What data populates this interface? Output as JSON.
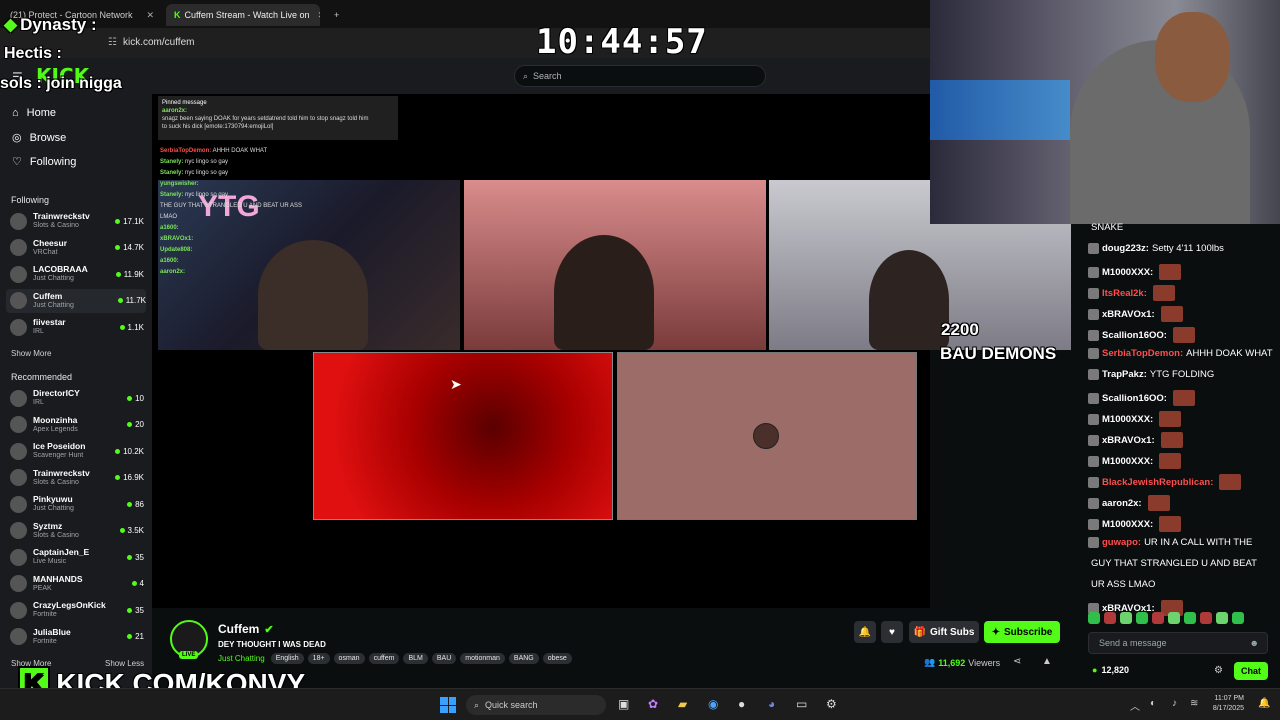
{
  "browser": {
    "tabs": [
      {
        "label": "(21) Protect - Cartoon Network",
        "active": false
      },
      {
        "label": "Cuffem Stream - Watch Live on",
        "active": true
      }
    ],
    "url": "kick.com/cuffem"
  },
  "overlay": {
    "clock": "10:44:57",
    "team": "Dynasty :",
    "user1": "Hectis :",
    "user2_text": "sols : join nigga",
    "brand": "KICK.COM/KONVY",
    "cam_label_line1": "2200",
    "cam_label_line2": "BAU DEMONS"
  },
  "search": {
    "placeholder": "Search"
  },
  "nav": {
    "home": "Home",
    "browse": "Browse",
    "following": "Following"
  },
  "following_title": "Following",
  "following": [
    {
      "name": "Trainwreckstv",
      "cat": "Slots & Casino",
      "viewers": "17.1K"
    },
    {
      "name": "Cheesur",
      "cat": "VRChat",
      "viewers": "14.7K"
    },
    {
      "name": "LACOBRAAA",
      "cat": "Just Chatting",
      "viewers": "11.9K"
    },
    {
      "name": "Cuffem",
      "cat": "Just Chatting",
      "viewers": "11.7K"
    },
    {
      "name": "fiivestar",
      "cat": "IRL",
      "viewers": "1.1K"
    }
  ],
  "show_more": "Show More",
  "recommended_title": "Recommended",
  "recommended": [
    {
      "name": "DirectorICY",
      "cat": "IRL",
      "viewers": "10"
    },
    {
      "name": "Moonzinha",
      "cat": "Apex Legends",
      "viewers": "20"
    },
    {
      "name": "Ice Poseidon",
      "cat": "Scavenger Hunt",
      "viewers": "10.2K"
    },
    {
      "name": "Trainwreckstv",
      "cat": "Slots & Casino",
      "viewers": "16.9K"
    },
    {
      "name": "Pinkyuwu",
      "cat": "Just Chatting",
      "viewers": "86"
    },
    {
      "name": "Syztmz",
      "cat": "Slots & Casino",
      "viewers": "3.5K"
    },
    {
      "name": "CaptainJen_E",
      "cat": "Live Music",
      "viewers": "35"
    },
    {
      "name": "MANHANDS",
      "cat": "PEAK",
      "viewers": "4"
    },
    {
      "name": "CrazyLegsOnKick",
      "cat": "Fortnite",
      "viewers": "35"
    },
    {
      "name": "JuliaBlue",
      "cat": "Fortnite",
      "viewers": "21"
    }
  ],
  "show_less": "Show Less",
  "pinned": {
    "title": "Pinned message",
    "user": "aaron2x:",
    "text1": "snagz been saying DOAK for years setdatrend told him to stop snagz told him",
    "text2": "to suck his dick [emote:1730794:emojiLol]"
  },
  "overlay_chat": [
    {
      "user": "SerbiaTopDemon:",
      "text": "AHHH DOAK WHAT"
    },
    {
      "user": "Stanely:",
      "text": "nyc lingo so gay"
    },
    {
      "user": "Stanely:",
      "text": "nyc lingo so gay"
    },
    {
      "user": "yungswisher:",
      "text": ""
    },
    {
      "user": "Stanely:",
      "text": "nyc lingo so gay"
    },
    {
      "user": "",
      "text": "THE GUY THAT STRANGLED U AND BEAT UR ASS"
    },
    {
      "user": "",
      "text": "LMAO"
    },
    {
      "user": "a1600:",
      "text": ""
    },
    {
      "user": "xBRAVOx1:",
      "text": ""
    },
    {
      "user": "Update808:",
      "text": ""
    },
    {
      "user": "a1600:",
      "text": ""
    },
    {
      "user": "aaron2x:",
      "text": ""
    }
  ],
  "stream": {
    "live_badge": "LIVE",
    "streamer": "Cuffem",
    "title": "DEY THOUGHT I WAS DEAD",
    "category": "Just Chatting",
    "tags": [
      "English",
      "18+",
      "osman",
      "cuffem",
      "BLM",
      "BAU",
      "motionman",
      "BANG",
      "obese"
    ],
    "viewers": "11,692",
    "viewers_label": "Viewers",
    "gift_label": "Gift Subs",
    "subscribe_label": "Subscribe"
  },
  "chat": {
    "messages": [
      {
        "user": "",
        "text": "SNAKE",
        "color": "#ffffff"
      },
      {
        "user": "doug223z:",
        "text": "Setty 4'11 100lbs",
        "color": "#ffffff"
      },
      {
        "user": "M1000XXX:",
        "text": "",
        "color": "#ffffff"
      },
      {
        "user": "ItsReal2k:",
        "text": "",
        "color": "#ff4d4d"
      },
      {
        "user": "xBRAVOx1:",
        "text": "",
        "color": "#ffffff"
      },
      {
        "user": "Scallion16OO:",
        "text": "",
        "color": "#ffffff"
      },
      {
        "user": "SerbiaTopDemon:",
        "text": "AHHH DOAK WHAT",
        "color": "#ff4d4d"
      },
      {
        "user": "TrapPakz:",
        "text": "YTG FOLDING",
        "color": "#ffffff"
      },
      {
        "user": "Scallion16OO:",
        "text": "",
        "color": "#ffffff"
      },
      {
        "user": "M1000XXX:",
        "text": "",
        "color": "#ffffff"
      },
      {
        "user": "xBRAVOx1:",
        "text": "",
        "color": "#ffffff"
      },
      {
        "user": "M1000XXX:",
        "text": "",
        "color": "#ffffff"
      },
      {
        "user": "BlackJewishRepublican:",
        "text": "",
        "color": "#ff4d4d"
      },
      {
        "user": "aaron2x:",
        "text": "",
        "color": "#ffffff"
      },
      {
        "user": "M1000XXX:",
        "text": "",
        "color": "#ffffff"
      },
      {
        "user": "guwapo:",
        "text": "UR IN A CALL WITH THE",
        "color": "#ff4d4d"
      },
      {
        "user": "",
        "text": "GUY THAT STRANGLED U AND BEAT",
        "color": "#ffffff"
      },
      {
        "user": "",
        "text": "UR ASS LMAO",
        "color": "#ffffff"
      },
      {
        "user": "xBRAVOx1:",
        "text": "",
        "color": "#ffffff"
      }
    ],
    "input_placeholder": "Send a message",
    "points": "12,820",
    "chat_button": "Chat"
  },
  "taskbar": {
    "search_placeholder": "Quick search",
    "time": "11:07 PM",
    "date": "8/17/2025"
  },
  "colors": {
    "accent": "#53fc18",
    "bg": "#0b0e0f",
    "panel": "#191b1f"
  }
}
